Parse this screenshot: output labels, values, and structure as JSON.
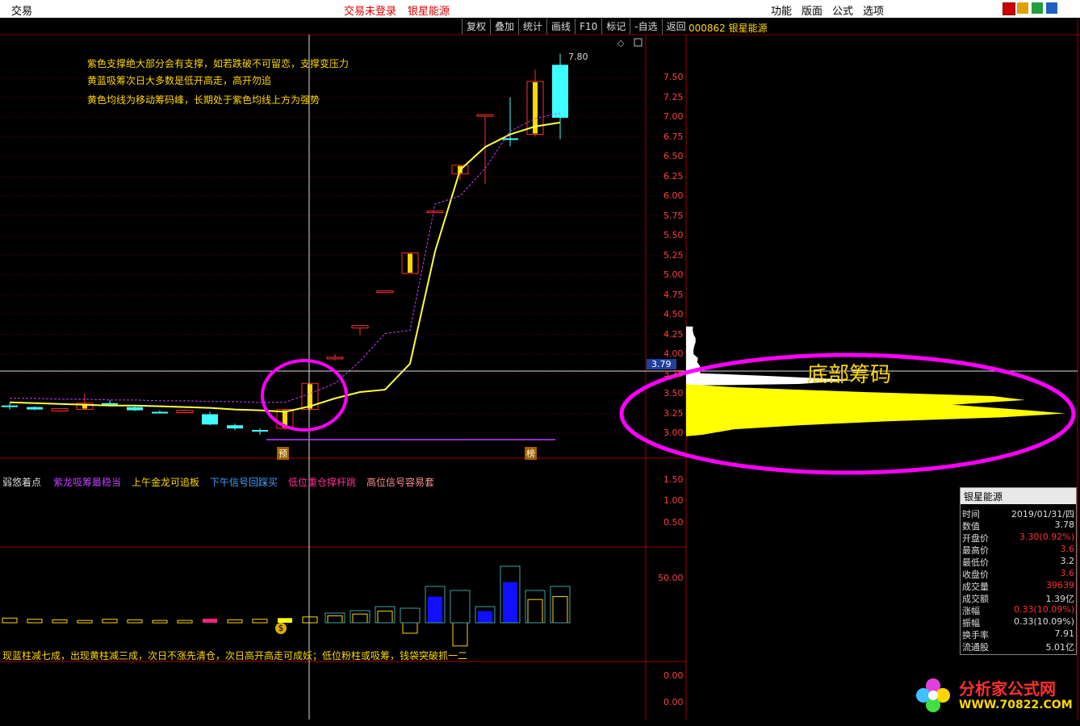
{
  "menu": {
    "trade": "交易",
    "not_logged": "交易未登录",
    "stock_name": "银星能源",
    "right_items": [
      "功能",
      "版面",
      "公式",
      "选项"
    ]
  },
  "toolbar": [
    "复权",
    "叠加",
    "统计",
    "画线",
    "F10",
    "标记",
    "-自选",
    "返回"
  ],
  "stock_title": "000862 银星能源",
  "notes": [
    "紫色支撑绝大部分会有支撑，如若跌破不可留恋，支撑变压力",
    "黄蓝吸筹次日大多数是低开高走，高开勿追",
    "黄色均线为移动筹码峰，长期处于紫色均线上方为强势"
  ],
  "signals": [
    {
      "text": "弱悠着点",
      "color": "#dddddd"
    },
    {
      "text": "紫龙吸筹最稳当",
      "color": "#c040ff"
    },
    {
      "text": "上午金龙可追板",
      "color": "#ffd700"
    },
    {
      "text": "下午信号回踩买",
      "color": "#40a0ff"
    },
    {
      "text": "低位重仓撑杆跳",
      "color": "#ff3090"
    },
    {
      "text": "高位信号容易套",
      "color": "#ff9090"
    }
  ],
  "warning_text": "现蓝柱减七成，出现黄柱减三成，次日不涨先清仓，次日高开高走可成妖；低位粉柱或吸筹，钱袋突破抓一二",
  "price_axis": [
    "7.50",
    "7.25",
    "7.00",
    "6.75",
    "6.50",
    "6.25",
    "6.00",
    "5.75",
    "5.50",
    "5.25",
    "5.00",
    "4.75",
    "4.50",
    "4.25",
    "4.00",
    "3.75",
    "3.50",
    "3.25",
    "3.00"
  ],
  "sub_axis": [
    "1.50",
    "1.00",
    "0.50"
  ],
  "vol_axis": [
    "50.00"
  ],
  "bottom_axis": [
    "0.00",
    "0.00"
  ],
  "cursor_price": "3.79",
  "high_marker": "7.80",
  "markers": {
    "pre": "预",
    "bang": "榜"
  },
  "chip_label": "底部筹码",
  "infobox": {
    "title": "银星能源",
    "rows": [
      {
        "k": "时间",
        "v": "2019/01/31/四",
        "red": false
      },
      {
        "k": "数值",
        "v": "3.78",
        "red": false
      },
      {
        "k": "开盘价",
        "v": "3.30(0.92%)",
        "red": true
      },
      {
        "k": "最高价",
        "v": "3.6",
        "red": true
      },
      {
        "k": "最低价",
        "v": "3.2",
        "red": false
      },
      {
        "k": "收盘价",
        "v": "3.6",
        "red": true
      },
      {
        "k": "成交量",
        "v": "39639",
        "red": true
      },
      {
        "k": "成交额",
        "v": "1.39亿",
        "red": false
      },
      {
        "k": "涨幅",
        "v": "0.33(10.09%)",
        "red": true
      },
      {
        "k": "振幅",
        "v": "0.33(10.09%)",
        "red": false
      },
      {
        "k": "换手率",
        "v": "7.91",
        "red": false
      },
      {
        "k": "流通股",
        "v": "5.01亿",
        "red": false
      }
    ]
  },
  "logo": {
    "name": "分析家公式网",
    "url": "WWW.70822.COM"
  },
  "chart_data": {
    "type": "candlestick",
    "candles": [
      {
        "o": 3.35,
        "c": 3.33,
        "h": 3.38,
        "l": 3.3,
        "color": "cyan"
      },
      {
        "o": 3.33,
        "c": 3.3,
        "h": 3.34,
        "l": 3.29,
        "color": "cyan"
      },
      {
        "o": 3.28,
        "c": 3.31,
        "h": 3.32,
        "l": 3.27,
        "color": "red"
      },
      {
        "o": 3.3,
        "c": 3.38,
        "h": 3.5,
        "l": 3.29,
        "color": "red"
      },
      {
        "o": 3.38,
        "c": 3.37,
        "h": 3.42,
        "l": 3.35,
        "color": "cyan"
      },
      {
        "o": 3.33,
        "c": 3.29,
        "h": 3.35,
        "l": 3.28,
        "color": "cyan"
      },
      {
        "o": 3.27,
        "c": 3.26,
        "h": 3.29,
        "l": 3.25,
        "color": "cyan"
      },
      {
        "o": 3.26,
        "c": 3.29,
        "h": 3.3,
        "l": 3.25,
        "color": "red"
      },
      {
        "o": 3.24,
        "c": 3.11,
        "h": 3.27,
        "l": 3.1,
        "color": "cyan"
      },
      {
        "o": 3.1,
        "c": 3.06,
        "h": 3.12,
        "l": 3.04,
        "color": "cyan"
      },
      {
        "o": 3.04,
        "c": 3.02,
        "h": 3.06,
        "l": 2.98,
        "color": "cyan"
      },
      {
        "o": 3.06,
        "c": 3.3,
        "h": 3.3,
        "l": 3.04,
        "color": "red"
      },
      {
        "o": 3.3,
        "c": 3.63,
        "h": 3.63,
        "l": 3.28,
        "color": "red"
      },
      {
        "o": 3.96,
        "c": 3.96,
        "h": 4.0,
        "l": 3.92,
        "color": "red"
      },
      {
        "o": 4.36,
        "c": 4.33,
        "h": 4.36,
        "l": 4.24,
        "color": "red"
      },
      {
        "o": 4.8,
        "c": 4.8,
        "h": 4.8,
        "l": 4.8,
        "color": "red"
      },
      {
        "o": 5.02,
        "c": 5.28,
        "h": 5.28,
        "l": 5.02,
        "color": "red"
      },
      {
        "o": 5.81,
        "c": 5.81,
        "h": 5.81,
        "l": 5.81,
        "color": "red"
      },
      {
        "o": 6.28,
        "c": 6.39,
        "h": 6.39,
        "l": 6.2,
        "color": "red"
      },
      {
        "o": 7.03,
        "c": 7.03,
        "h": 7.03,
        "l": 6.15,
        "color": "red"
      },
      {
        "o": 6.73,
        "c": 6.71,
        "h": 7.25,
        "l": 6.63,
        "color": "cyan"
      },
      {
        "o": 6.78,
        "c": 7.45,
        "h": 7.6,
        "l": 6.75,
        "color": "red"
      },
      {
        "o": 7.66,
        "c": 6.99,
        "h": 7.8,
        "l": 6.72,
        "color": "cyan"
      }
    ],
    "volume": [
      {
        "v": 8,
        "t": "o"
      },
      {
        "v": 6,
        "t": "o"
      },
      {
        "v": 5,
        "t": "o"
      },
      {
        "v": 4,
        "t": "o"
      },
      {
        "v": 6,
        "t": "o"
      },
      {
        "v": 5,
        "t": "o"
      },
      {
        "v": 4,
        "t": "o"
      },
      {
        "v": 4,
        "t": "o"
      },
      {
        "v": 7,
        "t": "p"
      },
      {
        "v": 5,
        "t": "o"
      },
      {
        "v": 6,
        "t": "o"
      },
      {
        "v": 8,
        "t": "y"
      },
      {
        "v": 10,
        "t": "o"
      },
      {
        "v": 12,
        "t": "o"
      },
      {
        "v": 15,
        "t": "o"
      },
      {
        "v": 20,
        "t": "o"
      },
      {
        "v": -18,
        "t": "o"
      },
      {
        "v": 45,
        "t": "b"
      },
      {
        "v": -40,
        "t": "o"
      },
      {
        "v": 20,
        "t": "b"
      },
      {
        "v": 70,
        "t": "b"
      },
      {
        "v": 40,
        "t": "o"
      },
      {
        "v": 45,
        "t": "o"
      }
    ]
  }
}
